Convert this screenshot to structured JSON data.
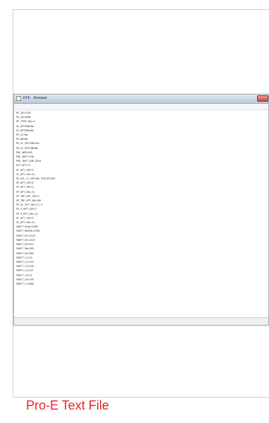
{
  "caption": "Pro-E Text File",
  "window": {
    "title": "DFE - Notepad",
    "menu": [
      "File",
      "Edit",
      "Format",
      "View",
      "Help"
    ]
  },
  "file_lines": [
    "PE_ID=1235",
    "PE_LN=2000",
    "PE_TYPE_HAL=1",
    "SC_OPTION=No",
    "SC_OPTION=No",
    "PE_SC=No",
    "PE_WW=No",
    "PE_SC_OPTION=Yes",
    "PE_SC_OPTION=No",
    "PAE_ADM=105",
    "PAE_INST=236",
    "PAE_INST_SUB_ID=0",
    "EXT_OPT=11",
    "SC_OPT_SEP=2",
    "SC_OPT_HAL=11",
    "PE_SCL_CY_OPT=No 3232332202",
    "PE_OPT_SEP=2",
    "SP_OPT_SEP=2",
    "SP_OPT_HAL=11",
    "SP_TRE_OPT_SEP=2",
    "SP_TRE_OPT_HAL=60",
    "SP_SL_OPT_HAL=11.3",
    "SP_S_OPT_SEP=2",
    "SP_S_OPT_HAL=11",
    "SC_OPT_SEP=2",
    "SC_OPT_HAL=11",
    "SHAFT_Diam=1485",
    "SHAFT_DRCDE=1230",
    "SHAFT_D1=2125",
    "SHAFT_D2=2125",
    "SHAFT_D3=515",
    "SHAFT_Mm=265",
    "SHAFT_D4=504",
    "SHAFT_L1=15",
    "SHAFT_L2=225",
    "SHAFT_L3=135",
    "SHAFT_L4=227",
    "SHAFT_L5=31",
    "SHAFT_L6=435",
    "SHAFT_L7=860"
  ]
}
